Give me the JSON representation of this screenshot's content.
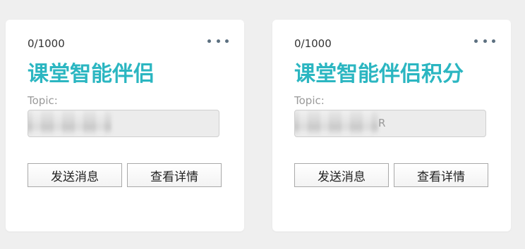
{
  "colors": {
    "background": "#efefef",
    "card": "#ffffff",
    "title": "#2bb6c1",
    "more_dots": "#5c7080"
  },
  "cards": [
    {
      "count": "0/1000",
      "title": "课堂智能伴侣",
      "topic_label": "Topic:",
      "topic_value_visible": "",
      "send_label": "发送消息",
      "detail_label": "查看详情",
      "more_icon": "more-horizontal-icon"
    },
    {
      "count": "0/1000",
      "title": "课堂智能伴侣积分",
      "topic_label": "Topic:",
      "topic_value_visible": "R",
      "send_label": "发送消息",
      "detail_label": "查看详情",
      "more_icon": "more-horizontal-icon"
    }
  ]
}
